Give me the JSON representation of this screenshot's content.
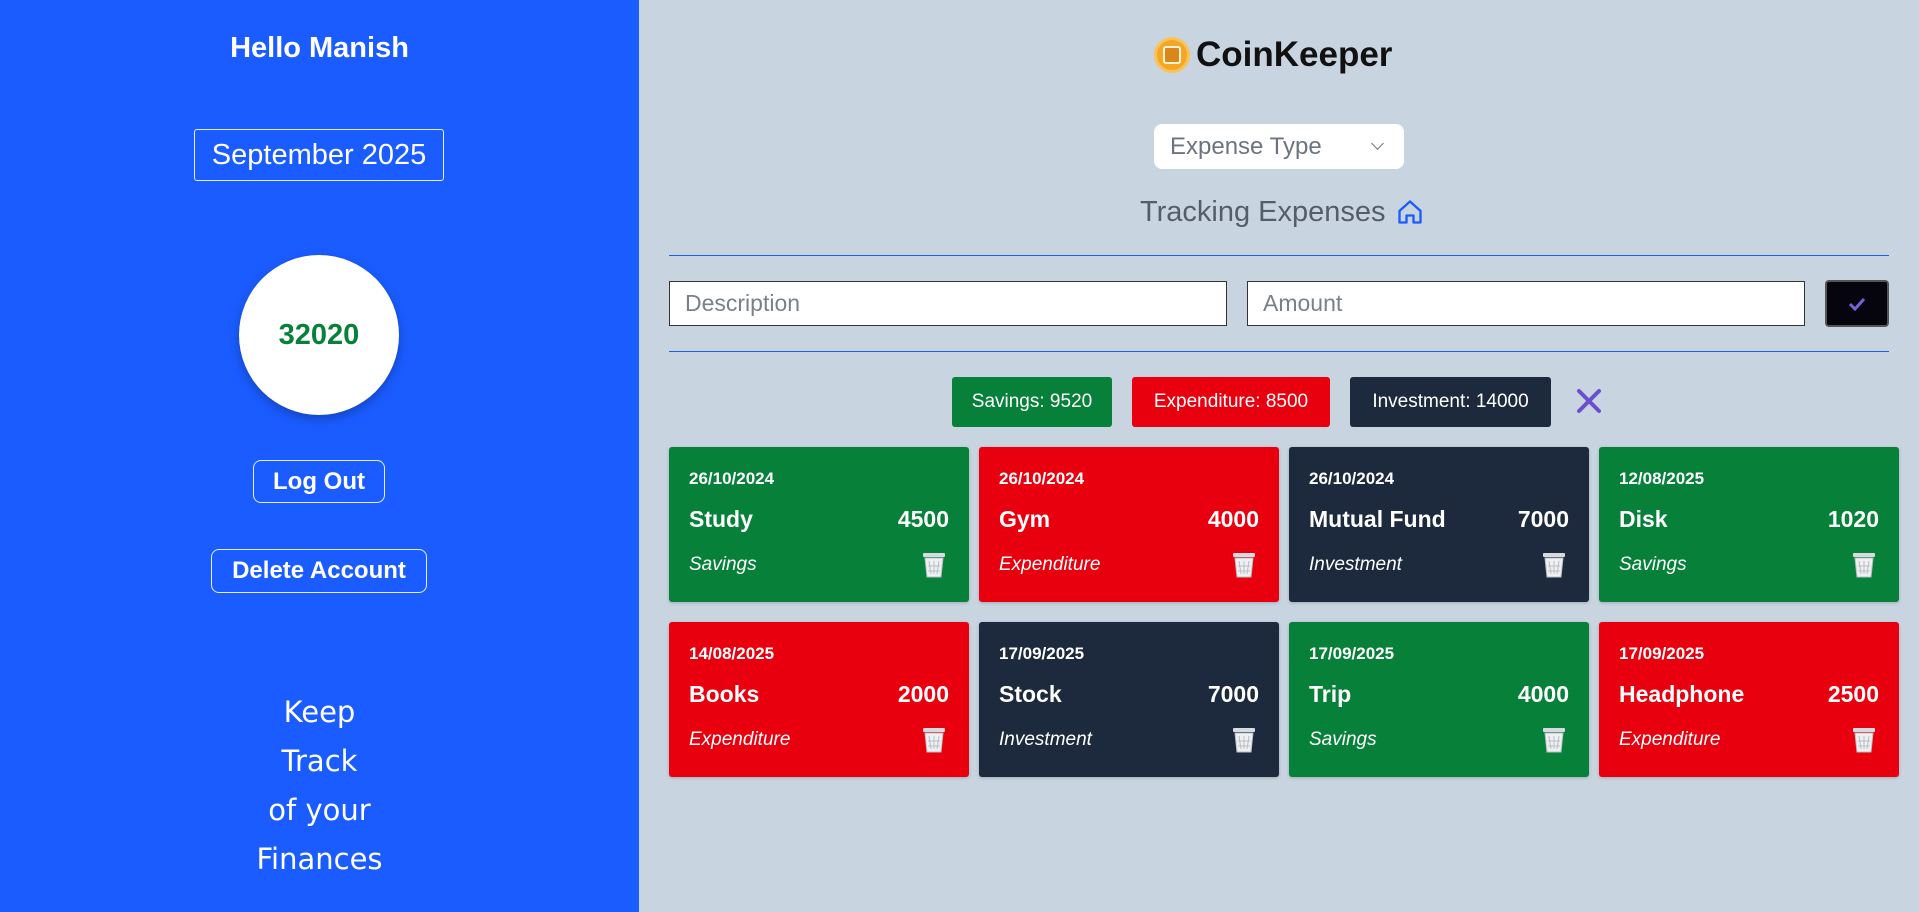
{
  "sidebar": {
    "greeting": "Hello Manish",
    "month": "September 2025",
    "balance": "32020",
    "logout_label": "Log Out",
    "delete_label": "Delete Account",
    "tagline": [
      "Keep",
      "Track",
      "of your",
      "Finances"
    ]
  },
  "header": {
    "brand": "CoinKeeper",
    "brand_icon": "coin-icon"
  },
  "filter": {
    "expense_type_placeholder": "Expense Type"
  },
  "tracking": {
    "label": "Tracking Expenses",
    "icon": "home-icon"
  },
  "form": {
    "description_placeholder": "Description",
    "amount_placeholder": "Amount",
    "submit_icon": "check-icon"
  },
  "summary": {
    "savings": "Savings: 9520",
    "expenditure": "Expenditure: 8500",
    "investment": "Investment: 14000",
    "clear_icon": "close-icon"
  },
  "transactions": [
    {
      "date": "26/10/2024",
      "description": "Study",
      "amount": "4500",
      "type": "Savings",
      "kind": "savings"
    },
    {
      "date": "26/10/2024",
      "description": "Gym",
      "amount": "4000",
      "type": "Expenditure",
      "kind": "expenditure"
    },
    {
      "date": "26/10/2024",
      "description": "Mutual Fund",
      "amount": "7000",
      "type": "Investment",
      "kind": "investment"
    },
    {
      "date": "12/08/2025",
      "description": "Disk",
      "amount": "1020",
      "type": "Savings",
      "kind": "savings"
    },
    {
      "date": "14/08/2025",
      "description": "Books",
      "amount": "2000",
      "type": "Expenditure",
      "kind": "expenditure"
    },
    {
      "date": "17/09/2025",
      "description": "Stock",
      "amount": "7000",
      "type": "Investment",
      "kind": "investment"
    },
    {
      "date": "17/09/2025",
      "description": "Trip",
      "amount": "4000",
      "type": "Savings",
      "kind": "savings"
    },
    {
      "date": "17/09/2025",
      "description": "Headphone",
      "amount": "2500",
      "type": "Expenditure",
      "kind": "expenditure"
    }
  ],
  "colors": {
    "sidebar_bg": "#1a5cff",
    "main_bg": "#c8d4e0",
    "savings": "#07813a",
    "expenditure": "#e8000f",
    "investment": "#1d2a3d",
    "balance_text": "#07813a"
  }
}
